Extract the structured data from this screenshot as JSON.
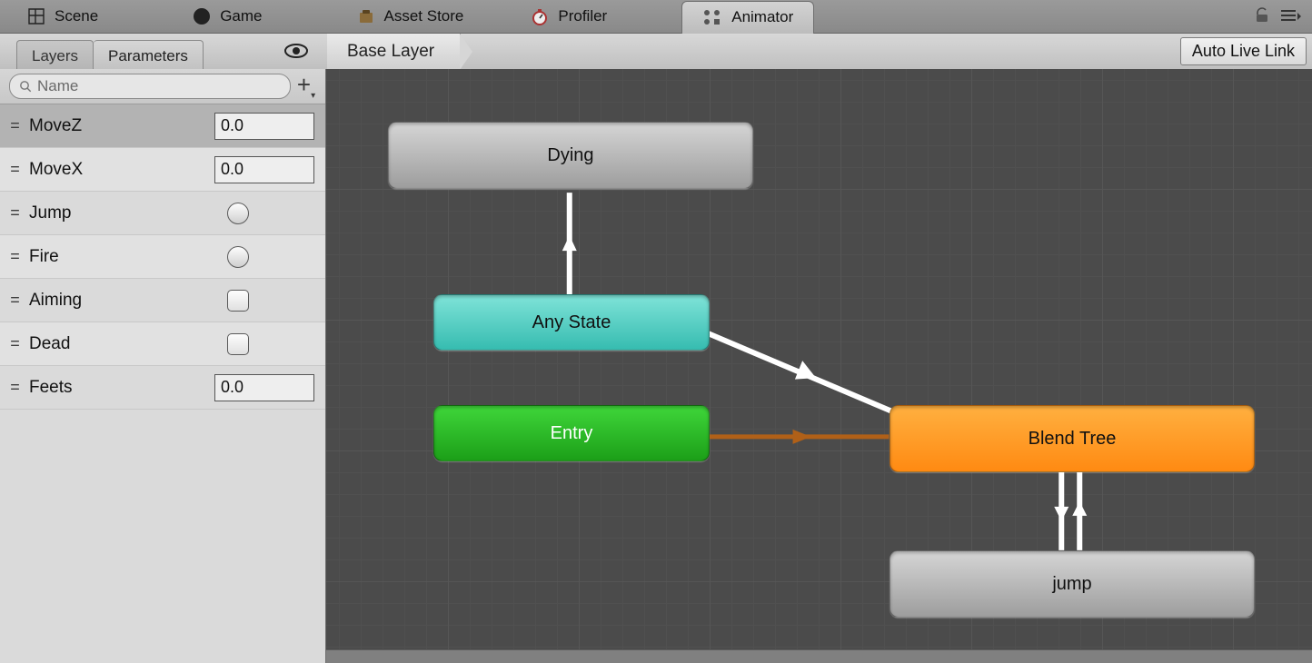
{
  "tabs": [
    {
      "label": "Scene",
      "icon": "scene-icon"
    },
    {
      "label": "Game",
      "icon": "game-icon"
    },
    {
      "label": "Asset Store",
      "icon": "asset-store-icon"
    },
    {
      "label": "Profiler",
      "icon": "profiler-icon"
    },
    {
      "label": "Animator",
      "icon": "animator-icon"
    }
  ],
  "activeTab": 4,
  "secondary": {
    "subtabs": [
      "Layers",
      "Parameters"
    ],
    "activeSub": 1,
    "breadcrumb": "Base Layer",
    "autoLiveLink": "Auto Live Link",
    "searchPlaceholder": "Name"
  },
  "parameters": [
    {
      "name": "MoveZ",
      "type": "float",
      "value": "0.0",
      "selected": true
    },
    {
      "name": "MoveX",
      "type": "float",
      "value": "0.0"
    },
    {
      "name": "Jump",
      "type": "trigger"
    },
    {
      "name": "Fire",
      "type": "trigger"
    },
    {
      "name": "Aiming",
      "type": "bool",
      "value": false
    },
    {
      "name": "Dead",
      "type": "bool",
      "value": false
    },
    {
      "name": "Feets",
      "type": "float",
      "value": "0.0"
    }
  ],
  "nodes": {
    "dying": {
      "label": "Dying"
    },
    "anyState": {
      "label": "Any State"
    },
    "entry": {
      "label": "Entry"
    },
    "blendTree": {
      "label": "Blend Tree"
    },
    "jump": {
      "label": "jump"
    }
  },
  "transitions": [
    {
      "from": "anyState",
      "to": "dying"
    },
    {
      "from": "anyState",
      "to": "blendTree"
    },
    {
      "from": "entry",
      "to": "blendTree",
      "default": true
    },
    {
      "from": "blendTree",
      "to": "jump",
      "bidirectional": true
    }
  ]
}
